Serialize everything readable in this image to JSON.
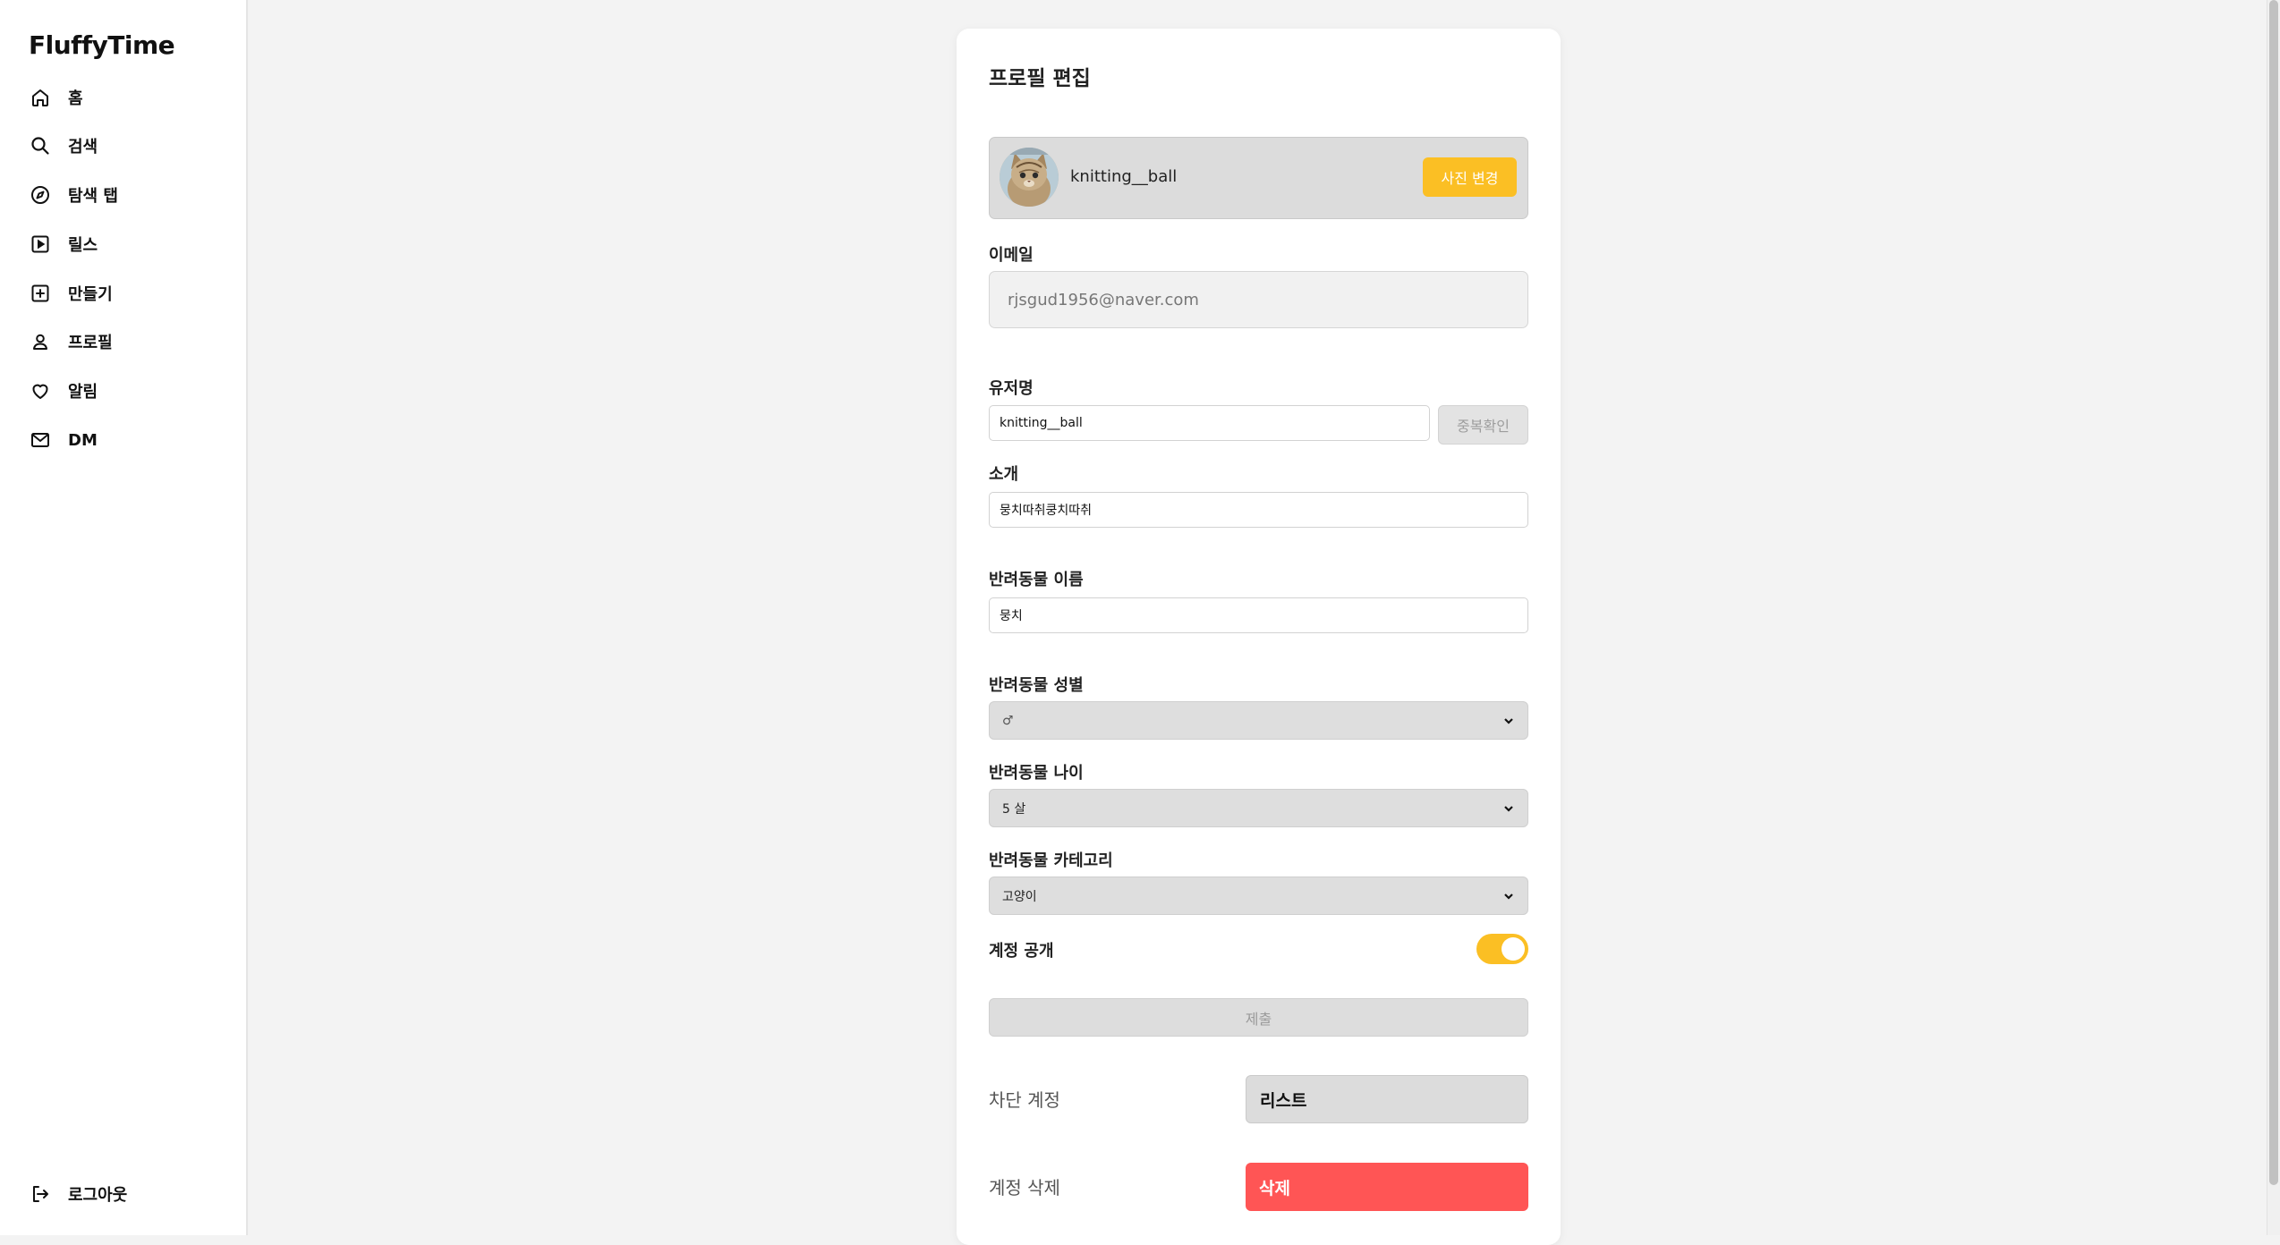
{
  "sidebar": {
    "brand": "FluffyTime",
    "items": [
      {
        "label": "홈",
        "icon": "home-icon"
      },
      {
        "label": "검색",
        "icon": "search-icon"
      },
      {
        "label": "탐색 탭",
        "icon": "compass-icon"
      },
      {
        "label": "릴스",
        "icon": "reels-icon"
      },
      {
        "label": "만들기",
        "icon": "plus-square-icon"
      },
      {
        "label": "프로필",
        "icon": "user-icon"
      },
      {
        "label": "알림",
        "icon": "heart-icon"
      },
      {
        "label": "DM",
        "icon": "mail-icon"
      }
    ],
    "logout": {
      "label": "로그아웃",
      "icon": "logout-icon"
    }
  },
  "profile_edit": {
    "title": "프로필 편집",
    "photo": {
      "username": "knitting__ball",
      "change_button": "사진 변경"
    },
    "email": {
      "label": "이메일",
      "value": "rjsgud1956@naver.com"
    },
    "username": {
      "label": "유저명",
      "value": "knitting__ball",
      "dup_check_button": "중복확인"
    },
    "intro": {
      "label": "소개",
      "value": "뭉치따취쿵치따취"
    },
    "pet_name": {
      "label": "반려동물 이름",
      "value": "뭉치"
    },
    "pet_gender": {
      "label": "반려동물 성별",
      "selected": "♂"
    },
    "pet_age": {
      "label": "반려동물 나이",
      "selected": "5 살"
    },
    "pet_category": {
      "label": "반려동물 카테고리",
      "selected": "고양이"
    },
    "account_public": {
      "label": "계정 공개",
      "enabled": true
    },
    "submit_button": "제출",
    "blocked_accounts": {
      "label": "차단 계정",
      "button": "리스트"
    },
    "delete_account": {
      "label": "계정 삭제",
      "button": "삭제"
    }
  },
  "colors": {
    "accent": "#fbbf24",
    "danger": "#ff5555",
    "background": "#f3f3f3"
  }
}
